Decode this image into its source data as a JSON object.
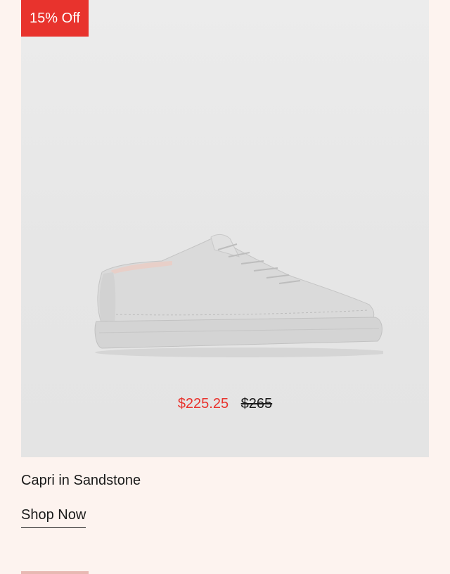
{
  "badge": {
    "label": "15% Off"
  },
  "product": {
    "name": "Capri in Sandstone",
    "sale_price": "$225.25",
    "original_price": "$265",
    "image_icon": "sneaker-image"
  },
  "cta": {
    "label": "Shop Now"
  },
  "colors": {
    "accent": "#e8332d",
    "background": "#fdf3ef",
    "image_bg": "#e8e8e8",
    "text": "#1a1a1a"
  }
}
